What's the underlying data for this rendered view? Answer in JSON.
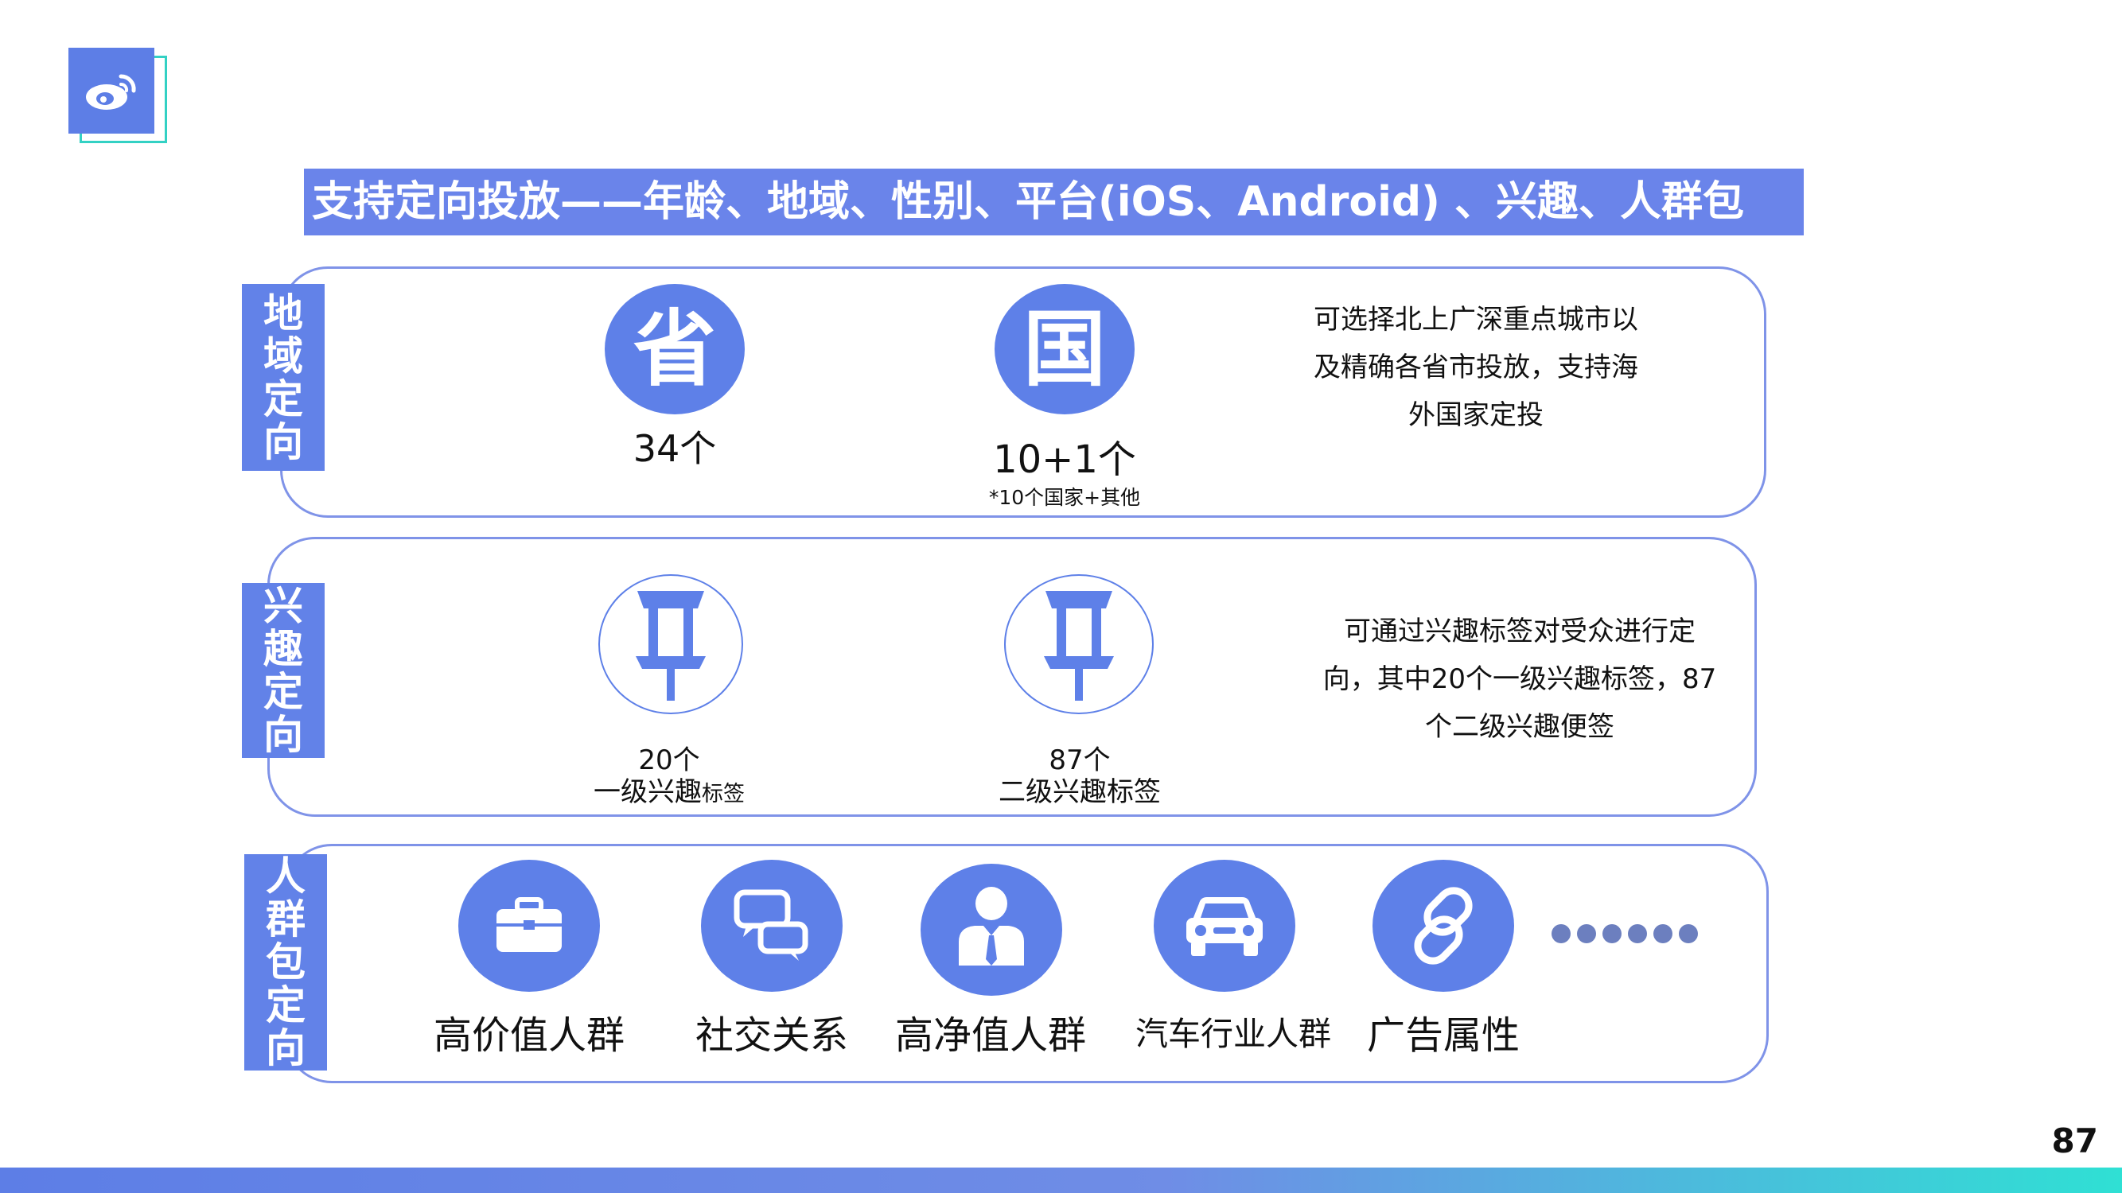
{
  "logo": {
    "icon": "weibo-icon"
  },
  "title": "支持定向投放——年龄、地域、性别、平台(iOS、Android) 、兴趣、人群包",
  "geo": {
    "tab_label": "地域定向",
    "province": {
      "icon_char": "省",
      "count": "34个"
    },
    "country": {
      "icon_char": "国",
      "count": "10+1个",
      "note": "*10个国家+其他"
    },
    "description": [
      "可选择北上广深重点城市以",
      "及精确各省市投放，支持海",
      "外国家定投"
    ]
  },
  "interest": {
    "tab_label": "兴趣定向",
    "level1": {
      "count": "20个",
      "label_main": "一级兴趣",
      "label_small": "标签",
      "icon": "pushpin-icon"
    },
    "level2": {
      "count": "87个",
      "label": "二级兴趣标签",
      "icon": "pushpin-icon"
    },
    "description": [
      "可通过兴趣标签对受众进行定",
      "向，其中20个一级兴趣标签，87",
      "个二级兴趣便签"
    ]
  },
  "audience": {
    "tab_label": "人群包定向",
    "items": [
      {
        "label": "高价值人群",
        "icon": "briefcase-icon"
      },
      {
        "label": "社交关系",
        "icon": "chat-bubbles-icon"
      },
      {
        "label": "高净值人群",
        "icon": "businessman-icon"
      },
      {
        "label": "汽车行业人群",
        "icon": "car-icon"
      },
      {
        "label": "广告属性",
        "icon": "link-chain-icon"
      }
    ]
  },
  "page_number": "87",
  "colors": {
    "primary": "#5e80e8",
    "accent": "#33d1c4"
  }
}
